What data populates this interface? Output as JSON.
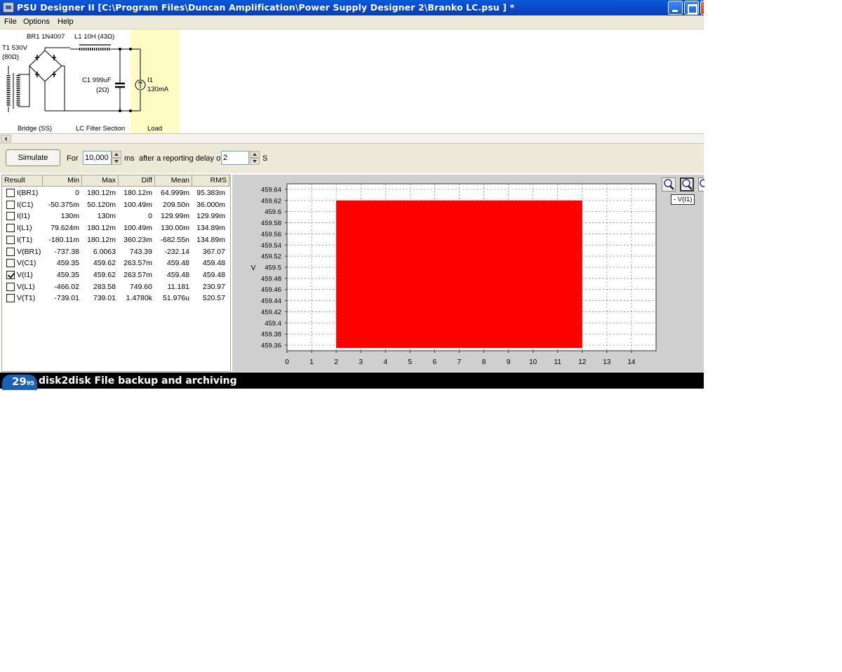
{
  "window": {
    "title": "PSU Designer II  [C:\\Program Files\\Duncan Amplification\\Power Supply Designer 2\\Branko  LC.psu ] *"
  },
  "menu": [
    "File",
    "Options",
    "Help"
  ],
  "schematic": {
    "transformer": {
      "name": "T1 530V",
      "resistance": "(80Ω)"
    },
    "rectifier": "BR1 1N4007",
    "inductor": "L1 10H (43Ω)",
    "capacitor": {
      "name": "C1 999uF",
      "esr": "(2Ω)"
    },
    "load": {
      "name": "I1",
      "value": "130mA"
    },
    "sections": [
      "Bridge (SS)",
      "LC Filter Section",
      "Load"
    ]
  },
  "simulate": {
    "button_label": "Simulate",
    "for_label": "For",
    "duration_value": "10,000",
    "duration_unit": "ms",
    "delay_label": "after a reporting delay of",
    "delay_value": "2",
    "delay_unit": "S"
  },
  "results": {
    "columns": [
      "Result",
      "Min",
      "Max",
      "Diff",
      "Mean",
      "RMS"
    ],
    "rows": [
      {
        "name": "I(BR1)",
        "checked": false,
        "min": "0",
        "max": "180.12m",
        "diff": "180.12m",
        "mean": "64.999m",
        "rms": "95.383m"
      },
      {
        "name": "I(C1)",
        "checked": false,
        "min": "-50.375m",
        "max": "50.120m",
        "diff": "100.49m",
        "mean": "209.50n",
        "rms": "36.000m"
      },
      {
        "name": "I(I1)",
        "checked": false,
        "min": "130m",
        "max": "130m",
        "diff": "0",
        "mean": "129.99m",
        "rms": "129.99m"
      },
      {
        "name": "I(L1)",
        "checked": false,
        "min": "79.624m",
        "max": "180.12m",
        "diff": "100.49m",
        "mean": "130.00m",
        "rms": "134.89m"
      },
      {
        "name": "I(T1)",
        "checked": false,
        "min": "-180.11m",
        "max": "180.12m",
        "diff": "360.23m",
        "mean": "-682.55n",
        "rms": "134.89m"
      },
      {
        "name": "V(BR1)",
        "checked": false,
        "min": "-737.38",
        "max": "6.0063",
        "diff": "743.39",
        "mean": "-232.14",
        "rms": "367.07"
      },
      {
        "name": "V(C1)",
        "checked": false,
        "min": "459.35",
        "max": "459.62",
        "diff": "263.57m",
        "mean": "459.48",
        "rms": "459.48"
      },
      {
        "name": "V(I1)",
        "checked": true,
        "min": "459.35",
        "max": "459.62",
        "diff": "263.57m",
        "mean": "459.48",
        "rms": "459.48"
      },
      {
        "name": "V(L1)",
        "checked": false,
        "min": "-466.02",
        "max": "283.58",
        "diff": "749.60",
        "mean": "11.181",
        "rms": "230.97"
      },
      {
        "name": "V(T1)",
        "checked": false,
        "min": "-739.01",
        "max": "739.01",
        "diff": "1.4780k",
        "mean": "51.976u",
        "rms": "520.57"
      }
    ]
  },
  "chart_data": {
    "type": "area",
    "ylabel": "V",
    "ylim": [
      459.35,
      459.65
    ],
    "yticks": [
      "459.64",
      "459.62",
      "459.6",
      "459.58",
      "459.56",
      "459.54",
      "459.52",
      "459.5",
      "459.48",
      "459.46",
      "459.44",
      "459.42",
      "459.4",
      "459.38",
      "459.36"
    ],
    "xlim": [
      0,
      15
    ],
    "xticks": [
      "0",
      "1",
      "2",
      "3",
      "4",
      "5",
      "6",
      "7",
      "8",
      "9",
      "10",
      "11",
      "12",
      "13",
      "14"
    ],
    "grid": true,
    "series": [
      {
        "name": "- V(I1)",
        "color": "#ff0000",
        "x_start": 2,
        "x_end": 12,
        "y_min": 459.355,
        "y_max": 459.62
      }
    ]
  },
  "banner": {
    "logo_text": "29",
    "logo_sub": "95",
    "text": "disk2disk File backup and archiving"
  }
}
